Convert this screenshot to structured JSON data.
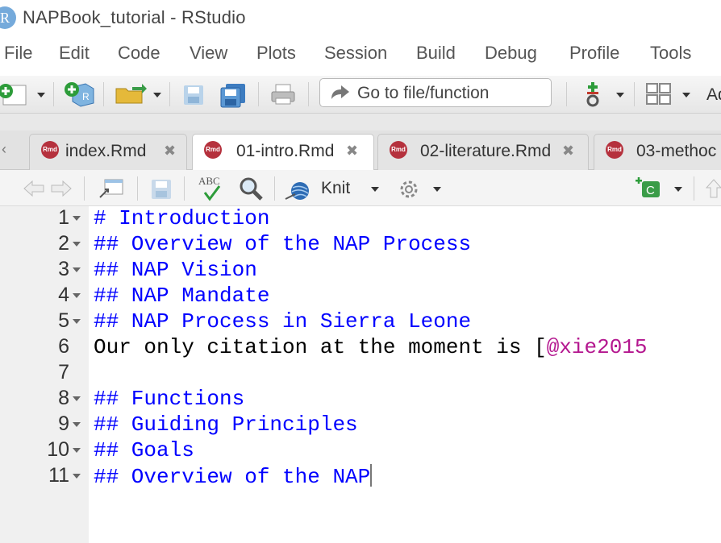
{
  "window": {
    "title": "NAPBook_tutorial - RStudio",
    "app_icon": "R"
  },
  "menu": [
    "File",
    "Edit",
    "Code",
    "View",
    "Plots",
    "Session",
    "Build",
    "Debug",
    "Profile",
    "Tools"
  ],
  "toolbar": {
    "goto_placeholder": "Go to file/function",
    "addins_label": "Ad"
  },
  "tabs": [
    {
      "label": "index.Rmd",
      "active": false
    },
    {
      "label": "01-intro.Rmd",
      "active": true
    },
    {
      "label": "02-literature.Rmd",
      "active": false
    },
    {
      "label": "03-methoc",
      "active": false
    }
  ],
  "rmd_badge": "Rmd",
  "editor_toolbar": {
    "knit_label": "Knit",
    "spell_label": "ABC",
    "chunk_label": "C"
  },
  "lines": [
    {
      "n": "1",
      "fold": true,
      "text": "# Introduction"
    },
    {
      "n": "2",
      "fold": true,
      "text": "## Overview of the NAP Process"
    },
    {
      "n": "3",
      "fold": true,
      "text": "## NAP Vision"
    },
    {
      "n": "4",
      "fold": true,
      "text": "## NAP Mandate"
    },
    {
      "n": "5",
      "fold": true,
      "text": "## NAP Process in Sierra Leone"
    },
    {
      "n": "6",
      "fold": false,
      "text": "Our only citation at the moment is [",
      "cite": "@xie2015"
    },
    {
      "n": "7",
      "fold": false,
      "text": ""
    },
    {
      "n": "8",
      "fold": true,
      "text": "## Functions"
    },
    {
      "n": "9",
      "fold": true,
      "text": "## Guiding Principles"
    },
    {
      "n": "10",
      "fold": true,
      "text": "## Goals"
    },
    {
      "n": "11",
      "fold": true,
      "text": "## Overview of the NAP"
    }
  ],
  "colors": {
    "header_text": "#0000ff",
    "citation": "#b4178f",
    "rmd_icon": "#b5313d"
  }
}
